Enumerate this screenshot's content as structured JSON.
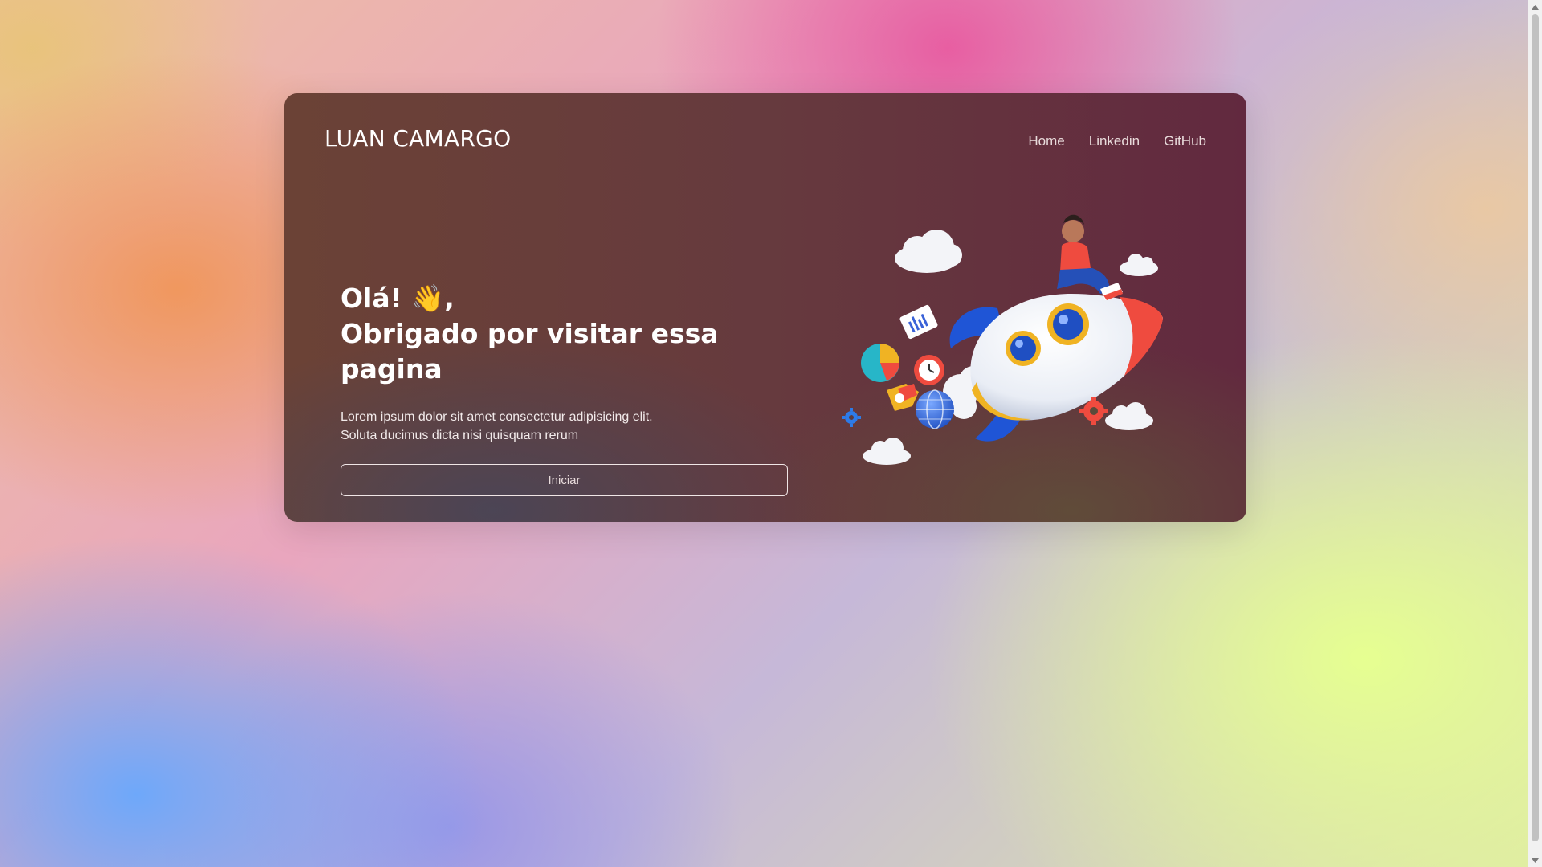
{
  "header": {
    "logo": "LUAN CAMARGO",
    "nav": [
      {
        "label": "Home"
      },
      {
        "label": "Linkedin"
      },
      {
        "label": "GitHub"
      }
    ]
  },
  "hero": {
    "greeting": "Olá! 👋,",
    "headline": "Obrigado por visitar essa pagina",
    "description": [
      "Lorem ipsum dolor sit amet consectetur adipisicing elit.",
      "Soluta ducimus dicta nisi quisquam rerum"
    ],
    "button_label": "Iniciar"
  },
  "illustration": {
    "icon": "rocket-illustration"
  },
  "colors": {
    "card_left": "#6b4236",
    "card_right": "#62293f",
    "rocket_blue": "#1f55d6",
    "rocket_red": "#ef4b3f"
  }
}
